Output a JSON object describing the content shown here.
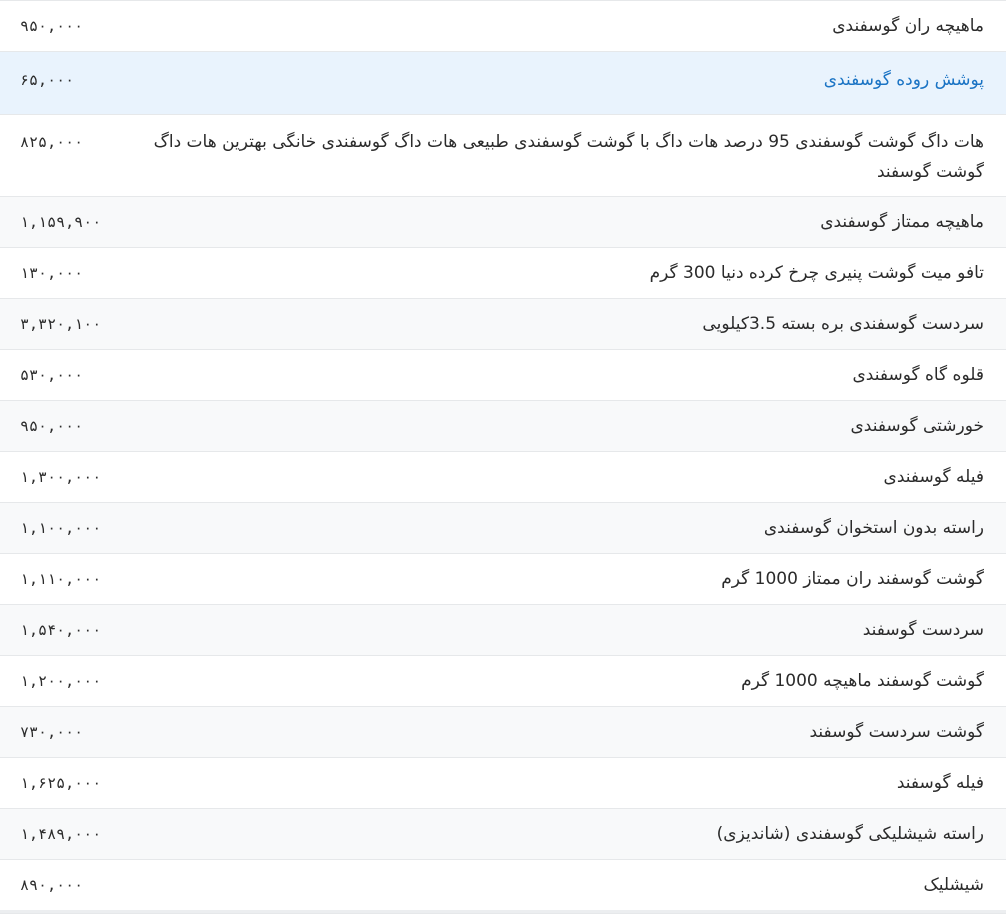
{
  "table": {
    "rows": [
      {
        "name": "ماهیچه ران گوسفندی",
        "price": "۹۵۰,۰۰۰"
      },
      {
        "name": "پوشش روده گوسفندی",
        "price": "۶۵,۰۰۰"
      },
      {
        "name": "هات داگ گوشت گوسفندی 95 درصد هات داگ با گوشت گوسفندی طبیعی هات داگ گوسفندی خانگی بهترین هات داگ گوشت گوسفند",
        "price": "۸۲۵,۰۰۰"
      },
      {
        "name": "ماهیچه ممتاز گوسفندی",
        "price": "۱,۱۵۹,۹۰۰"
      },
      {
        "name": "تافو میت گوشت پنیری چرخ کرده دنیا 300 گرم",
        "price": "۱۳۰,۰۰۰"
      },
      {
        "name": "سردست گوسفندی بره بسته 3.5کیلویی",
        "price": "۳,۳۲۰,۱۰۰"
      },
      {
        "name": "قلوه گاه گوسفندی",
        "price": "۵۳۰,۰۰۰"
      },
      {
        "name": "خورشتی گوسفندی",
        "price": "۹۵۰,۰۰۰"
      },
      {
        "name": "فیله گوسفندی",
        "price": "۱,۳۰۰,۰۰۰"
      },
      {
        "name": "راسته بدون استخوان گوسفندی",
        "price": "۱,۱۰۰,۰۰۰"
      },
      {
        "name": "گوشت گوسفند ران ممتاز 1000 گرم",
        "price": "۱,۱۱۰,۰۰۰"
      },
      {
        "name": "سردست گوسفند",
        "price": "۱,۵۴۰,۰۰۰"
      },
      {
        "name": "گوشت گوسفند ماهیچه 1000 گرم",
        "price": "۱,۲۰۰,۰۰۰"
      },
      {
        "name": "گوشت سردست گوسفند",
        "price": "۷۳۰,۰۰۰"
      },
      {
        "name": "فیله گوسفند",
        "price": "۱,۶۲۵,۰۰۰"
      },
      {
        "name": "راسته شیشلیکی گوسفندی (شاندیزی)",
        "price": "۱,۴۸۹,۰۰۰"
      },
      {
        "name": "شیشلیک",
        "price": "۸۹۰,۰۰۰"
      }
    ]
  },
  "colors": {
    "highlight_bg": "#e9f3fd",
    "link_text": "#1a73c4",
    "alt_row_bg": "#f8f9fa",
    "border": "#e6e8ea",
    "text": "#2b2b2b"
  }
}
